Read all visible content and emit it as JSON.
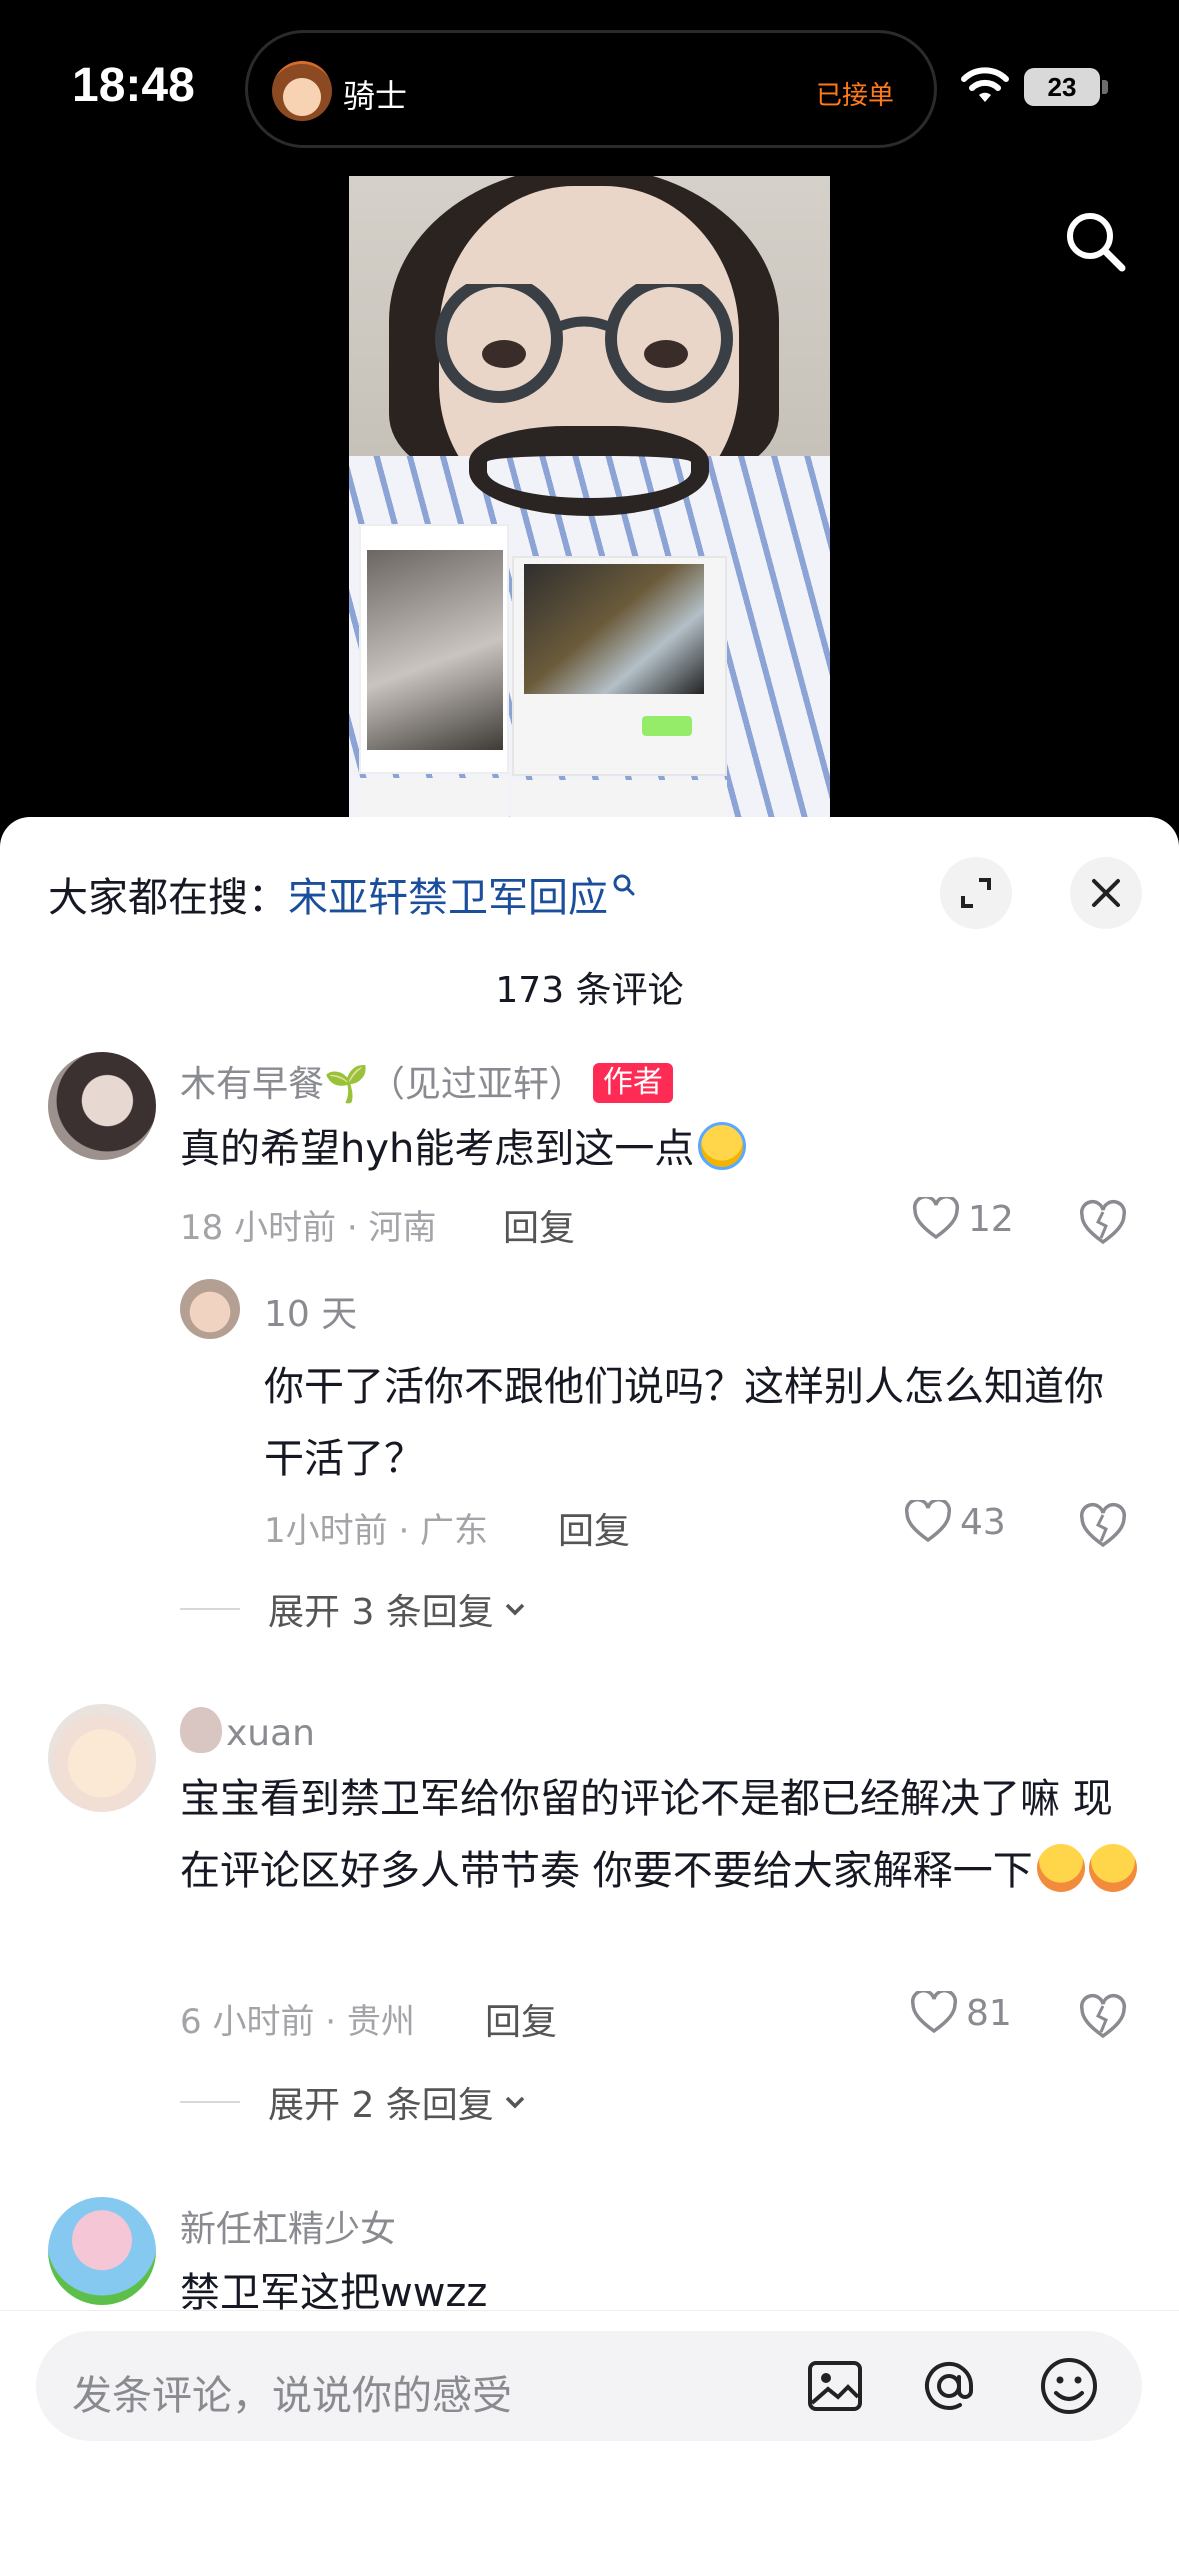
{
  "status_bar": {
    "time": "18:48",
    "island_title": "骑士",
    "island_status": "已接单",
    "battery": "23"
  },
  "colors": {
    "accent_red": "#fe2c55",
    "link_blue": "#1b4f9c",
    "island_orange": "#ff7a1a"
  },
  "icons": [
    "search-icon",
    "expand-icon",
    "close-icon",
    "heart-icon",
    "broken-heart-icon",
    "image-icon",
    "at-icon",
    "emoji-icon",
    "chevron-down-icon"
  ],
  "sheet": {
    "hot_search_prefix": "大家都在搜：",
    "hot_search_keyword": "宋亚轩禁卫军回应",
    "comment_count": "173 条评论"
  },
  "comments": [
    {
      "username": "木有早餐🌱（见过亚轩）",
      "author_tag": "作者",
      "text": "真的希望hyh能考虑到这一点",
      "meta": "18 小时前 · 河南",
      "reply_label": "回复",
      "likes": "12",
      "replies": [
        {
          "username": "10 天",
          "text": "你干了活你不跟他们说吗？这样别人怎么知道你干活了？",
          "meta": "1小时前 · 广东",
          "reply_label": "回复",
          "likes": "43"
        }
      ],
      "expand_label": "展开 3 条回复"
    },
    {
      "username": "xuan",
      "text": "宝宝看到禁卫军给你留的评论不是都已经解决了嘛 现在评论区好多人带节奏 你要不要给大家解释一下",
      "meta": "6 小时前 · 贵州",
      "reply_label": "回复",
      "likes": "81",
      "expand_label": "展开 2 条回复"
    },
    {
      "username": "新任杠精少女",
      "text": "禁卫军这把wwzz"
    }
  ],
  "input_bar": {
    "placeholder": "发条评论，说说你的感受"
  }
}
